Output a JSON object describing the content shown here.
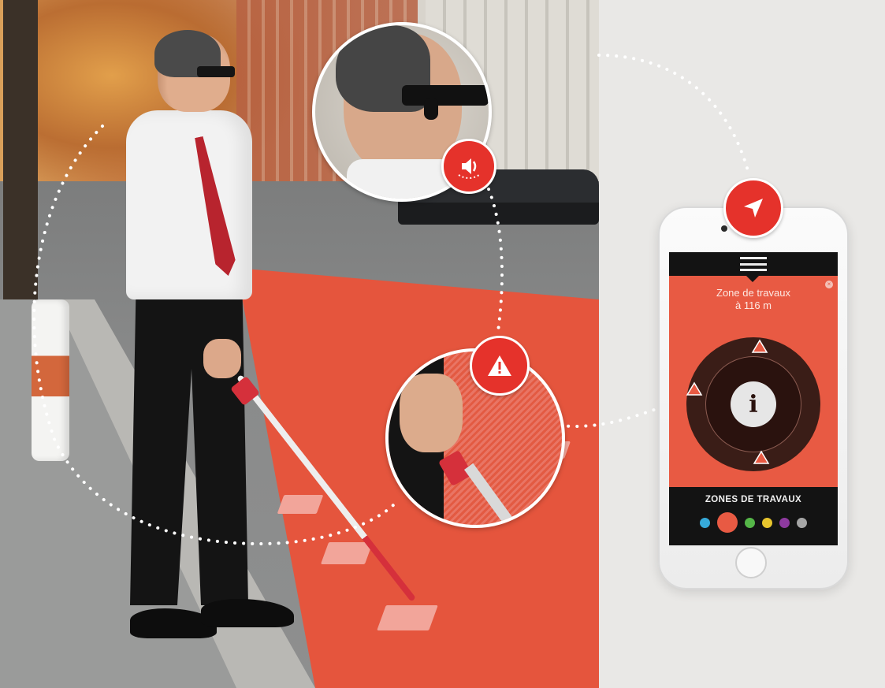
{
  "phone": {
    "zone_line_1": "Zone de travaux",
    "zone_line_2": "à 116 m",
    "info_glyph": "i",
    "close_glyph": "×",
    "legend_title": "ZONES DE TRAVAUX",
    "swatch_colors": [
      "#36a9d9",
      "#e85a43",
      "#55b648",
      "#e7c52d",
      "#8e3a9f",
      "#a5a5a5"
    ],
    "selected_swatch": 1
  },
  "icons": {
    "navigation": "navigation-arrow-icon",
    "audio": "speaker-icon",
    "warning": "warning-triangle-icon"
  },
  "colors": {
    "accent_red": "#e5322b",
    "screen_orange": "#e85a43",
    "radar_dark": "#3a1d17"
  }
}
